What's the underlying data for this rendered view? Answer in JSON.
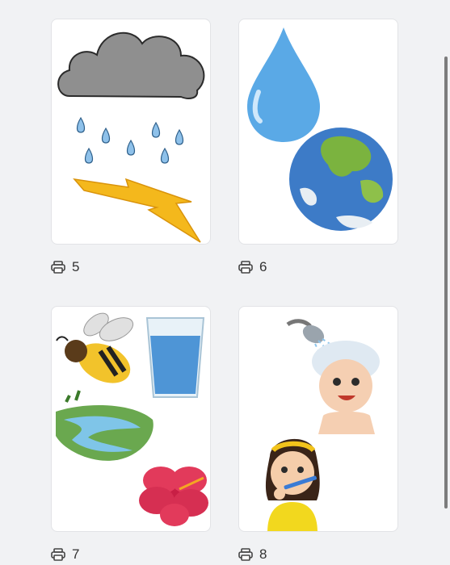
{
  "cards": [
    {
      "label": "5",
      "icon": "printer-icon",
      "scene": "rain-cloud-lightning"
    },
    {
      "label": "6",
      "icon": "printer-icon",
      "scene": "water-drop-earth"
    },
    {
      "label": "7",
      "icon": "printer-icon",
      "scene": "bee-water-river-flower"
    },
    {
      "label": "8",
      "icon": "printer-icon",
      "scene": "shower-brushing-teeth"
    }
  ],
  "colors": {
    "background": "#f1f2f4",
    "card": "#ffffff",
    "text": "#333333",
    "scrollbar": "#7c7c7c"
  }
}
